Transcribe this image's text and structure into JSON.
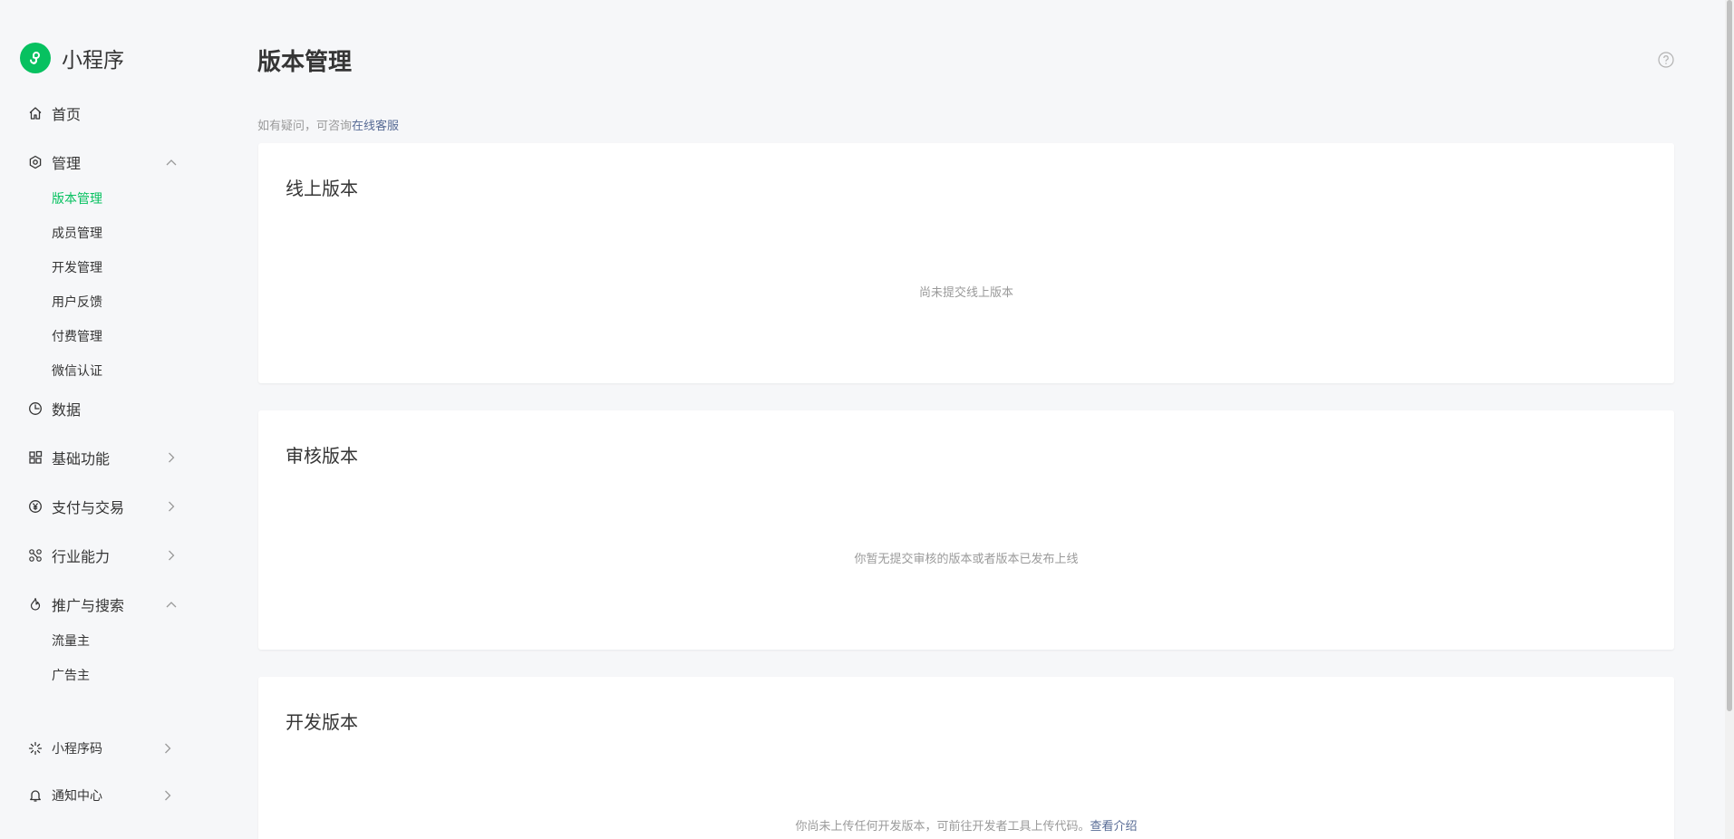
{
  "brand": {
    "name": "小程序",
    "logo_icon": "miniprogram-logo-icon",
    "color": "#07c160"
  },
  "sidebar": {
    "home": {
      "label": "首页",
      "icon": "home-icon"
    },
    "manage": {
      "label": "管理",
      "icon": "gear-icon",
      "expanded": true,
      "items": [
        {
          "label": "版本管理",
          "active": true
        },
        {
          "label": "成员管理"
        },
        {
          "label": "开发管理"
        },
        {
          "label": "用户反馈"
        },
        {
          "label": "付费管理"
        },
        {
          "label": "微信认证"
        }
      ]
    },
    "data": {
      "label": "数据",
      "icon": "pie-chart-icon"
    },
    "basic": {
      "label": "基础功能",
      "icon": "grid-icon"
    },
    "pay": {
      "label": "支付与交易",
      "icon": "yen-icon"
    },
    "industry": {
      "label": "行业能力",
      "icon": "molecule-icon"
    },
    "promo": {
      "label": "推广与搜索",
      "icon": "flame-icon",
      "expanded": true,
      "items": [
        {
          "label": "流量主"
        },
        {
          "label": "广告主"
        }
      ]
    },
    "qrcode": {
      "label": "小程序码",
      "icon": "sun-icon"
    },
    "notice": {
      "label": "通知中心",
      "icon": "bell-icon"
    }
  },
  "main": {
    "title": "版本管理",
    "tip_text": "如有疑问，可咨询",
    "tip_link": "在线客服",
    "sections": [
      {
        "title": "线上版本",
        "empty": "尚未提交线上版本"
      },
      {
        "title": "审核版本",
        "empty": "你暂无提交审核的版本或者版本已发布上线"
      },
      {
        "title": "开发版本",
        "empty": "你尚未上传任何开发版本，可前往开发者工具上传代码。",
        "link": "查看介绍"
      }
    ]
  },
  "colors": {
    "accent": "#07c160",
    "link": "#576b95",
    "muted": "#9a9a9a",
    "background": "#f6f7f9"
  }
}
